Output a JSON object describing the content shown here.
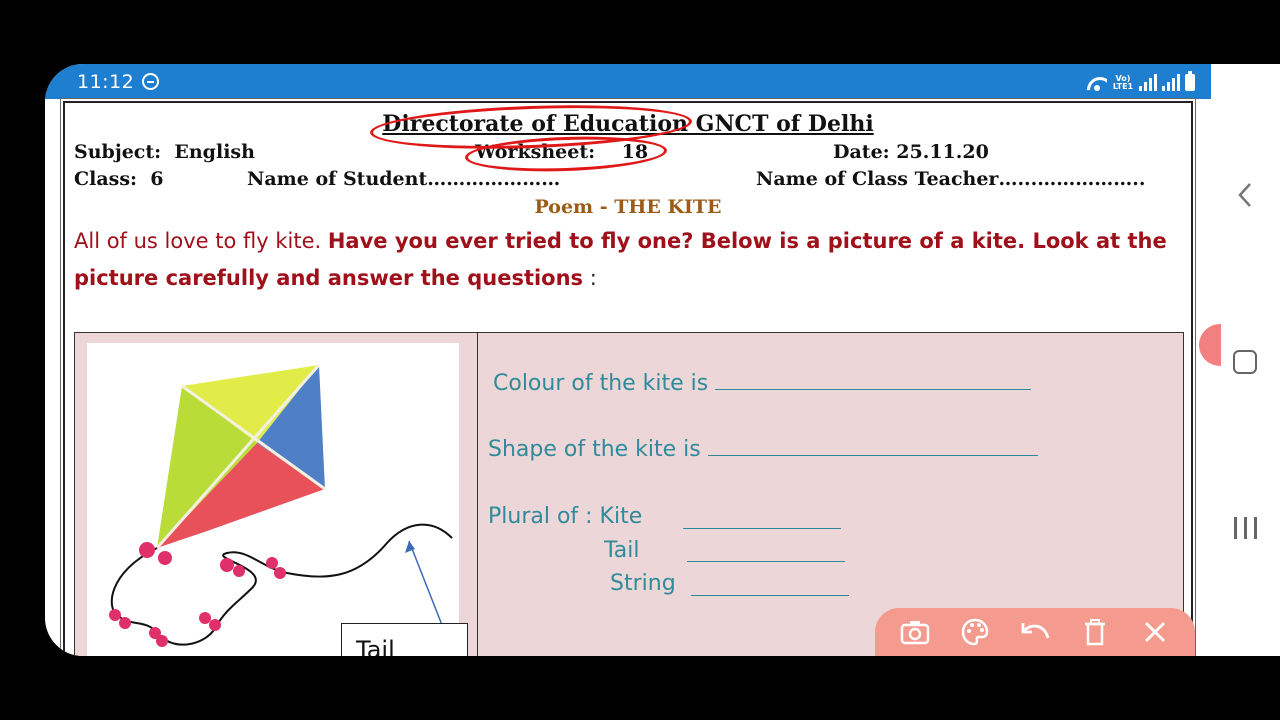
{
  "status_bar": {
    "time": "11:12",
    "network_label": "Vo) LTE1"
  },
  "document": {
    "header_title": "Directorate of Education GNCT of Delhi",
    "subject_label": "Subject:",
    "subject_value": "English",
    "worksheet_label": "Worksheet:",
    "worksheet_value": "18",
    "date_label": "Date: 25.11.20",
    "class_label": "Class:",
    "class_value": "6",
    "student_label": "Name of Student…………………",
    "teacher_label": "Name of Class Teacher…...……………..",
    "poem_title": "Poem - THE KITE",
    "intro_plain": "All of us love to fly kite.",
    "intro_bold": "Have you ever tried to fly one? Below is a picture of a kite. Look at the picture carefully and answer the questions",
    "intro_end": " :"
  },
  "panel": {
    "tail_label": "Tail",
    "q_colour": "Colour of the kite  is",
    "q_shape": "Shape of the kite  is",
    "q_plural": "Plural of : Kite",
    "q_tail": "Tail",
    "q_string": "String"
  },
  "toolbar": {
    "icons": [
      "camera-icon",
      "palette-icon",
      "undo-icon",
      "trash-icon",
      "close-icon"
    ]
  },
  "colors": {
    "status_bar": "#1e7fd0",
    "annotation_red": "#e01818",
    "panel_bg": "#ecd6d8",
    "question_teal": "#2f8a9a",
    "toolbar_bg": "#f59a8e"
  }
}
